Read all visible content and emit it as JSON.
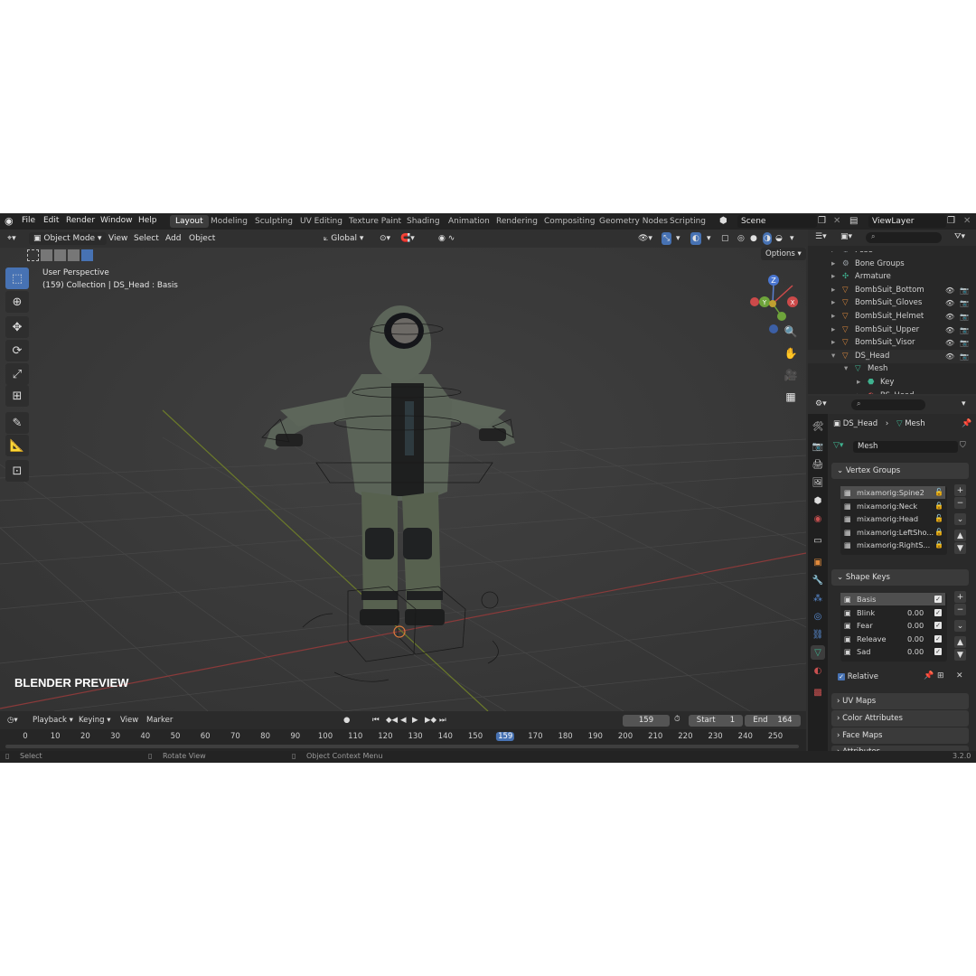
{
  "top_menu": {
    "items": [
      "File",
      "Edit",
      "Render",
      "Window",
      "Help"
    ],
    "workspaces": [
      "Layout",
      "Modeling",
      "Sculpting",
      "UV Editing",
      "Texture Paint",
      "Shading",
      "Animation",
      "Rendering",
      "Compositing",
      "Geometry Nodes",
      "Scripting"
    ],
    "active_workspace": "Layout",
    "scene": "Scene",
    "view_layer": "ViewLayer"
  },
  "viewport": {
    "mode": "Object Mode",
    "menus": [
      "View",
      "Select",
      "Add",
      "Object"
    ],
    "transform_orientation": "Global",
    "options_label": "Options",
    "perspective_label": "User Perspective",
    "collection_label": "(159) Collection | DS_Head : Basis",
    "watermark": "BLENDER PREVIEW",
    "gizmo_axes": [
      "Z",
      "Y",
      "X"
    ]
  },
  "outliner": {
    "rows": [
      {
        "label": "Pose",
        "indent": 2,
        "icon": "pose-icon",
        "color": "#9aa0a6"
      },
      {
        "label": "Bone Groups",
        "indent": 2,
        "icon": "bone-group-icon",
        "color": "#9aa0a6"
      },
      {
        "label": "Armature",
        "indent": 2,
        "icon": "armature-icon",
        "color": "#3fb28f",
        "has_vis": false
      },
      {
        "label": "BombSuit_Bottom",
        "indent": 2,
        "icon": "mesh-object-icon",
        "color": "#e08a3c",
        "has_vis": true
      },
      {
        "label": "BombSuit_Gloves",
        "indent": 2,
        "icon": "mesh-object-icon",
        "color": "#e08a3c",
        "has_vis": true
      },
      {
        "label": "BombSuit_Helmet",
        "indent": 2,
        "icon": "mesh-object-icon",
        "color": "#e08a3c",
        "has_vis": true
      },
      {
        "label": "BombSuit_Upper",
        "indent": 2,
        "icon": "mesh-object-icon",
        "color": "#e08a3c",
        "has_vis": true
      },
      {
        "label": "BombSuit_Visor",
        "indent": 2,
        "icon": "mesh-object-icon",
        "color": "#e08a3c",
        "has_vis": true
      },
      {
        "label": "DS_Head",
        "indent": 2,
        "icon": "mesh-object-icon",
        "color": "#e08a3c",
        "has_vis": true,
        "expanded": true
      },
      {
        "label": "Mesh",
        "indent": 3,
        "icon": "mesh-data-icon",
        "color": "#3fb28f",
        "expanded": true
      },
      {
        "label": "Key",
        "indent": 4,
        "icon": "shape-key-icon",
        "color": "#3fb28f"
      },
      {
        "label": "BS_Head",
        "indent": 4,
        "icon": "material-icon",
        "color": "#c85050"
      }
    ]
  },
  "properties": {
    "breadcrumb_object": "DS_Head",
    "breadcrumb_data": "Mesh",
    "data_name": "Mesh",
    "vertex_groups_title": "Vertex Groups",
    "vertex_groups": [
      {
        "name": "mixamorig:Spine2",
        "locked": false
      },
      {
        "name": "mixamorig:Neck",
        "locked": true
      },
      {
        "name": "mixamorig:Head",
        "locked": false
      },
      {
        "name": "mixamorig:LeftSho...",
        "locked": true
      },
      {
        "name": "mixamorig:RightS...",
        "locked": true
      }
    ],
    "shape_keys_title": "Shape Keys",
    "shape_keys": [
      {
        "name": "Basis",
        "value": ""
      },
      {
        "name": "Blink",
        "value": "0.00"
      },
      {
        "name": "Fear",
        "value": "0.00"
      },
      {
        "name": "Releave",
        "value": "0.00"
      },
      {
        "name": "Sad",
        "value": "0.00"
      }
    ],
    "relative_label": "Relative",
    "collapsed_panels": [
      "UV Maps",
      "Color Attributes",
      "Face Maps",
      "Attributes"
    ]
  },
  "timeline": {
    "menus": [
      "Playback",
      "Keying",
      "View",
      "Marker"
    ],
    "current_frame": "159",
    "start_label": "Start",
    "start_value": "1",
    "end_label": "End",
    "end_value": "164",
    "ruler": [
      "0",
      "10",
      "20",
      "30",
      "40",
      "50",
      "60",
      "70",
      "80",
      "90",
      "100",
      "110",
      "120",
      "130",
      "140",
      "150",
      "159",
      "170",
      "180",
      "190",
      "200",
      "210",
      "220",
      "230",
      "240",
      "250"
    ]
  },
  "status_bar": {
    "select": "Select",
    "rotate_view": "Rotate View",
    "context_menu": "Object Context Menu",
    "version": "3.2.0"
  },
  "colors": {
    "accent": "#4772b3",
    "frame_marker": "#4772b3"
  }
}
